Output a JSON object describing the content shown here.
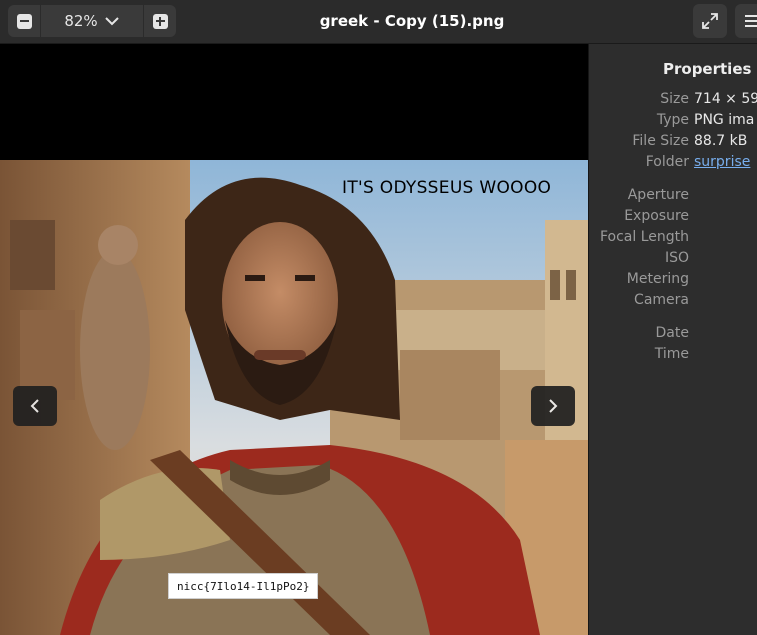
{
  "header": {
    "zoom_value": "82%",
    "title": "greek - Copy (15).png"
  },
  "image": {
    "caption": "IT'S ODYSSEUS WOOOO",
    "overlay_label": "nicc{7Ilo14-Il1pPo2}"
  },
  "properties": {
    "title": "Properties",
    "rows": [
      {
        "label": "Size",
        "value": "714 × 59"
      },
      {
        "label": "Type",
        "value": "PNG ima"
      },
      {
        "label": "File Size",
        "value": "88.7 kB"
      },
      {
        "label": "Folder",
        "value": "surprise"
      },
      {
        "label": "Aperture",
        "value": ""
      },
      {
        "label": "Exposure",
        "value": ""
      },
      {
        "label": "Focal Length",
        "value": ""
      },
      {
        "label": "ISO",
        "value": ""
      },
      {
        "label": "Metering",
        "value": ""
      },
      {
        "label": "Camera",
        "value": ""
      },
      {
        "label": "Date",
        "value": ""
      },
      {
        "label": "Time",
        "value": ""
      }
    ]
  },
  "colors": {
    "headerbar": "#2b2b2b",
    "sidebar": "#2d2d2d",
    "link": "#78aeed",
    "cape": "#9c2a1e"
  }
}
